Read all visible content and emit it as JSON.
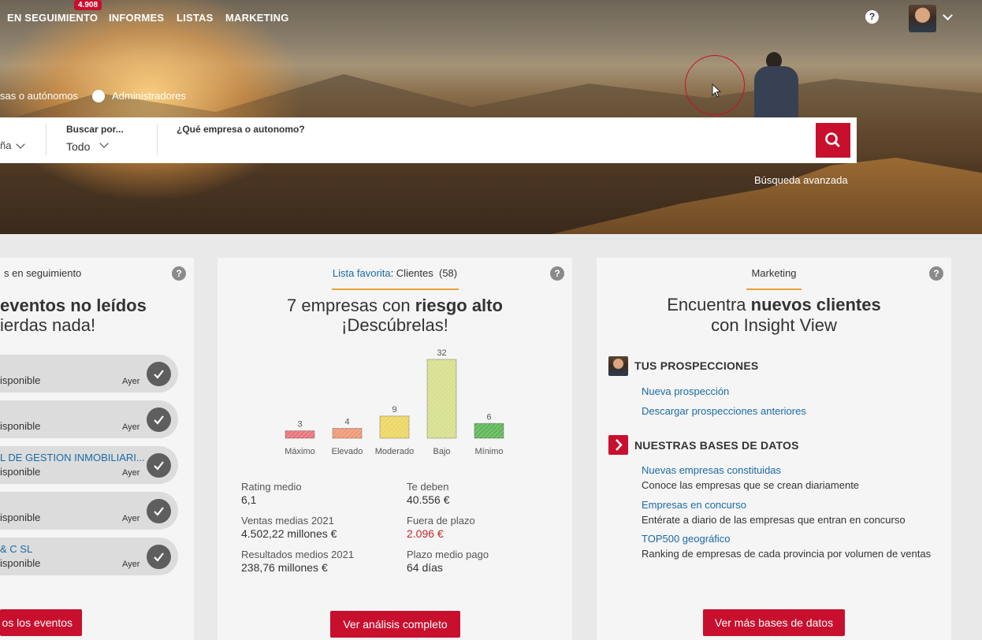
{
  "nav": {
    "items": [
      "EN SEGUIMIENTO",
      "INFORMES",
      "LISTAS",
      "MARKETING"
    ],
    "badge": "4.908"
  },
  "filters": {
    "radio1_label": "sas o autónomos",
    "radio2_label": "Administradores"
  },
  "search": {
    "country_value": "ña",
    "by_label": "Buscar por...",
    "by_value": "Todo",
    "query_label": "¿Qué empresa o autonomo?",
    "query_value": "",
    "advanced_link": "Búsqueda avanzada"
  },
  "following": {
    "tab": "s en seguimiento",
    "heading": "eventos no leídos",
    "subheading": "ierdas nada!",
    "events": [
      {
        "title": "",
        "status": "isponible",
        "date": "Ayer"
      },
      {
        "title": "",
        "status": "isponible",
        "date": "Ayer"
      },
      {
        "title": "L DE GESTION INMOBILIARI...",
        "status": "isponible",
        "date": "Ayer"
      },
      {
        "title": "",
        "status": "isponible",
        "date": "Ayer"
      },
      {
        "title": "& C SL",
        "status": "isponible",
        "date": "Ayer"
      }
    ],
    "button": "os los eventos"
  },
  "favorites": {
    "list_link": "Lista favorita",
    "list_name": ": Clientes",
    "list_count": "(58)",
    "title_prefix": "7 empresas con ",
    "title_bold": "riesgo alto",
    "subtitle": "¡Descúbrelas!",
    "stats": [
      {
        "label": "Rating medio",
        "value": "6,1"
      },
      {
        "label": "Te deben",
        "value": "40.556 €"
      },
      {
        "label": "Ventas medias 2021",
        "value": "4.502,22 millones €"
      },
      {
        "label": "Fuera de plazo",
        "value": "2.096 €"
      },
      {
        "label": "Resultados medios 2021",
        "value": "238,76 millones €"
      },
      {
        "label": "Plazo medio pago",
        "value": "64 días"
      }
    ],
    "button": "Ver análisis completo"
  },
  "chart_data": {
    "type": "bar",
    "categories": [
      "Máximo",
      "Elevado",
      "Moderado",
      "Bajo",
      "Mínimo"
    ],
    "values": [
      3,
      4,
      9,
      32,
      6
    ],
    "colors": [
      "#e8767c",
      "#ef9a79",
      "#ecd765",
      "#d7e090",
      "#62b85a"
    ]
  },
  "marketing": {
    "tab": "Marketing",
    "title_prefix": "Encuentra ",
    "title_bold": "nuevos clientes",
    "subtitle": "con Insight View",
    "section1_title": "TUS PROSPECCIONES",
    "section1_links": [
      "Nueva prospección",
      "Descargar prospecciones anteriores"
    ],
    "section2_title": "NUESTRAS BASES DE DATOS",
    "databases": [
      {
        "link": "Nuevas empresas constituidas",
        "desc": "Conoce las empresas que se crean diariamente"
      },
      {
        "link": "Empresas en concurso",
        "desc": "Entérate a diario de las empresas que entran en concurso"
      },
      {
        "link": "TOP500 geográfico",
        "desc": "Ranking de empresas de cada provincia por volumen de ventas"
      }
    ],
    "button": "Ver más bases de datos"
  },
  "help_glyph": "?",
  "colors": {
    "brand_red": "#c8102e",
    "link_blue": "#1a6aa6",
    "accent_orange": "#e7a23a",
    "overdue_red": "#c0282d"
  }
}
